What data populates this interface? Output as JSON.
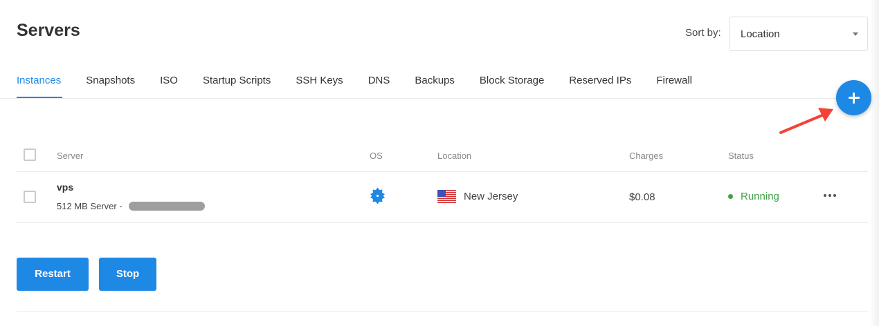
{
  "page": {
    "title": "Servers"
  },
  "sort": {
    "label": "Sort by:",
    "selected": "Location"
  },
  "tabs": [
    {
      "label": "Instances",
      "active": true
    },
    {
      "label": "Snapshots"
    },
    {
      "label": "ISO"
    },
    {
      "label": "Startup Scripts"
    },
    {
      "label": "SSH Keys"
    },
    {
      "label": "DNS"
    },
    {
      "label": "Backups"
    },
    {
      "label": "Block Storage"
    },
    {
      "label": "Reserved IPs"
    },
    {
      "label": "Firewall"
    }
  ],
  "fab": {
    "icon": "plus-icon"
  },
  "annotation": {
    "icon": "red-arrow-icon",
    "color": "#f44336"
  },
  "table": {
    "headers": {
      "server": "Server",
      "os": "OS",
      "location": "Location",
      "charges": "Charges",
      "status": "Status"
    },
    "rows": [
      {
        "name": "vps",
        "subtitle": "512 MB Server -",
        "os_icon": "os-gear-icon",
        "flag_icon": "us-flag-icon",
        "location": "New Jersey",
        "charges": "$0.08",
        "status": "Running",
        "status_color": "#43a047"
      }
    ]
  },
  "actions": {
    "restart": "Restart",
    "stop": "Stop"
  },
  "colors": {
    "accent": "#1e88e5",
    "success": "#43a047"
  }
}
